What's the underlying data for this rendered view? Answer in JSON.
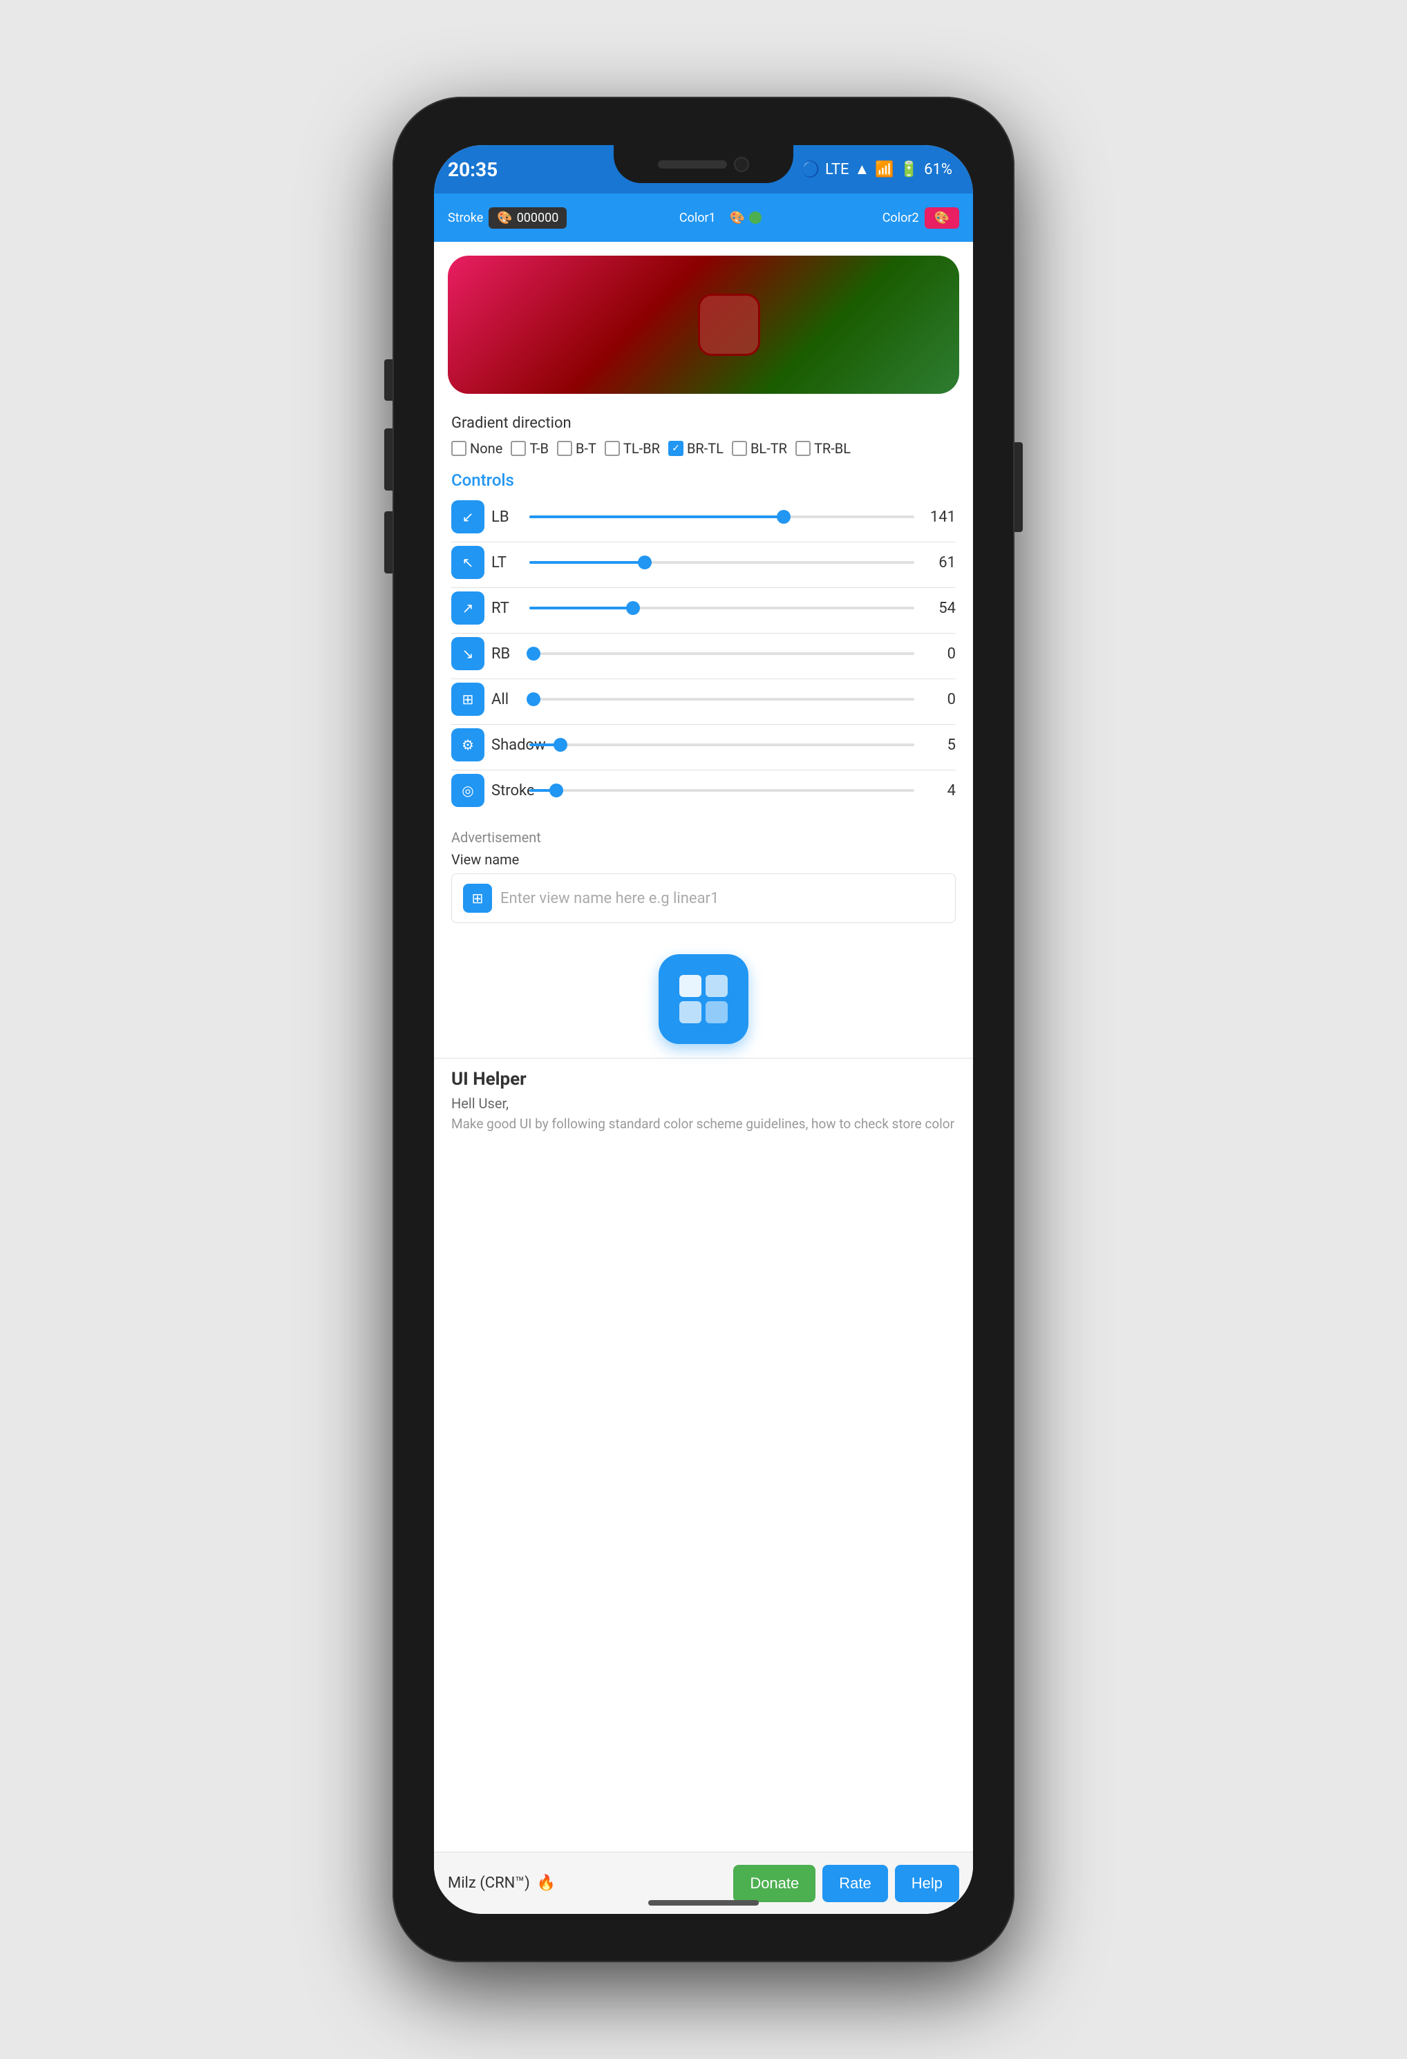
{
  "phone": {
    "status_bar": {
      "time": "20:35",
      "lte_label": "LTE",
      "battery": "61%"
    },
    "toolbar": {
      "stroke_label": "Stroke",
      "stroke_value": "000000",
      "color1_label": "Color1",
      "color1_value": "green",
      "color2_label": "Color2",
      "color2_value": "red_active"
    },
    "gradient_direction": {
      "title": "Gradient direction",
      "options": [
        "None",
        "T-B",
        "B-T",
        "TL-BR",
        "BR-TL",
        "BL-TR",
        "TR-BL"
      ],
      "checked": "BR-TL"
    },
    "controls": {
      "title": "Controls",
      "rows": [
        {
          "id": "LB",
          "label": "LB",
          "value": 141,
          "fill_pct": 66
        },
        {
          "id": "LT",
          "label": "LT",
          "value": 61,
          "fill_pct": 30
        },
        {
          "id": "RT",
          "label": "RT",
          "value": 54,
          "fill_pct": 27
        },
        {
          "id": "RB",
          "label": "RB",
          "value": 0,
          "fill_pct": 1
        },
        {
          "id": "All",
          "label": "All",
          "value": 0,
          "fill_pct": 1
        },
        {
          "id": "Shadow",
          "label": "Shadow",
          "value": 5,
          "fill_pct": 8
        },
        {
          "id": "Stroke",
          "label": "Stroke",
          "value": 4,
          "fill_pct": 7
        }
      ]
    },
    "advertisement": {
      "label": "Advertisement",
      "view_name_label": "View name",
      "placeholder": "Enter view name here e.g linear1"
    },
    "app": {
      "title": "UI Helper",
      "greeting": "Hell User,",
      "subtext": "Make good UI by following standard color scheme guidelines, how to check store color"
    },
    "bottom_bar": {
      "author": "Milz (CRN™)",
      "fire_emoji": "🔥",
      "donate_label": "Donate",
      "rate_label": "Rate",
      "help_label": "Help"
    }
  }
}
